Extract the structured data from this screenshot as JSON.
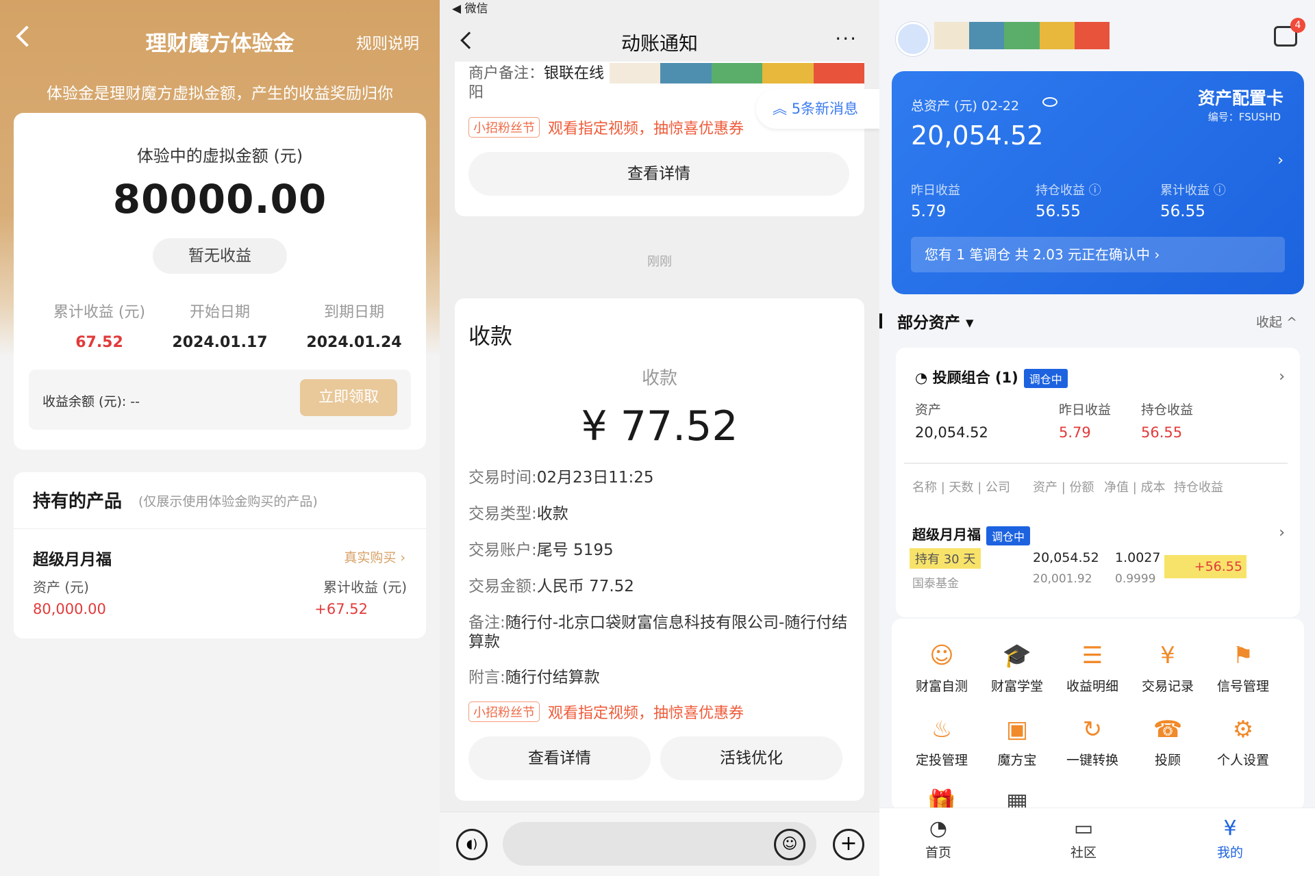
{
  "screen1": {
    "title": "理财魔方体验金",
    "rules_link": "规则说明",
    "subtitle": "体验金是理财魔方虚拟金额，产生的收益奖励归你",
    "virtual_label": "体验中的虚拟金额 (元)",
    "virtual_amount": "80000.00",
    "no_income": "暂无收益",
    "stats": [
      {
        "label": "累计收益 (元)",
        "value": "67.52"
      },
      {
        "label": "开始日期",
        "value": "2024.01.17"
      },
      {
        "label": "到期日期",
        "value": "2024.01.24"
      }
    ],
    "balance_label": "收益余额 (元): --",
    "claim_button": "立即领取",
    "holdings_title": "持有的产品",
    "holdings_note": "(仅展示使用体验金购买的产品)",
    "product_name": "超级月月福",
    "buy_link": "真实购买",
    "asset_label": "资产 (元)",
    "asset_value": "80,000.00",
    "cum_label": "累计收益 (元)",
    "cum_value": "+67.52"
  },
  "screen2": {
    "status": "◀ 微信",
    "title": "动账通知",
    "more": "···",
    "memo_key": "商户备注：",
    "memo_val": "银联在线",
    "memo_tail": "阳",
    "new_messages": "5条新消息",
    "promo_tag": "小招粉丝节",
    "promo_text": "观看指定视频，抽惊喜优惠券",
    "view_details": "查看详情",
    "time": "刚刚",
    "card_title": "收款",
    "card_sub": "收款",
    "amount": "¥ 77.52",
    "rows": [
      {
        "k": "交易时间:",
        "v": "02月23日11:25"
      },
      {
        "k": "交易类型:",
        "v": "收款"
      },
      {
        "k": "交易账户:",
        "v": "尾号 5195"
      },
      {
        "k": "交易金额:",
        "v": "人民币 77.52"
      },
      {
        "k": "备注:",
        "v": "随行付-北京口袋财富信息科技有限公司-随行付结算款"
      },
      {
        "k": "附言:",
        "v": "随行付结算款"
      }
    ],
    "btn_details": "查看详情",
    "btn_optimize": "活钱优化"
  },
  "screen3": {
    "badge": "4",
    "total_label": "总资产 (元)    02-22",
    "total": "20,054.52",
    "card_name": "资产配置卡",
    "card_no": "编号：FSUSHD",
    "metrics": [
      {
        "label": "昨日收益",
        "value": "5.79"
      },
      {
        "label": "持仓收益 ⓘ",
        "value": "56.55"
      },
      {
        "label": "累计收益 ⓘ",
        "value": "56.55"
      }
    ],
    "pending": "您有 1 笔调仓 共 2.03 元正在确认中  ›",
    "section": "部分资产 ▾",
    "collapse": "收起 ^",
    "group_title": "投顾组合 (1)",
    "tag_adjusting": "调仓中",
    "group_heads": [
      "资产",
      "昨日收益",
      "持仓收益"
    ],
    "group_vals": [
      "20,054.52",
      "5.79",
      "56.55"
    ],
    "table_heads": [
      "名称 | 天数 | 公司",
      "资产 | 份额",
      "净值 | 成本",
      "持仓收益"
    ],
    "fund_name": "超级月月福",
    "fund_hold": "持有 30 天",
    "fund_company": "国泰基金",
    "fund_asset": "20,054.52",
    "fund_share": "20,001.92",
    "fund_nav": "1.0027",
    "fund_cost": "0.9999",
    "fund_gain": "+56.55",
    "tools": [
      {
        "label": "财富自测",
        "icon": "☺"
      },
      {
        "label": "财富学堂",
        "icon": "🎓"
      },
      {
        "label": "收益明细",
        "icon": "☰"
      },
      {
        "label": "交易记录",
        "icon": "¥"
      },
      {
        "label": "信号管理",
        "icon": "⚑"
      },
      {
        "label": "定投管理",
        "icon": "♨"
      },
      {
        "label": "魔方宝",
        "icon": "▣"
      },
      {
        "label": "一键转换",
        "icon": "↻"
      },
      {
        "label": "投顾",
        "icon": "☎"
      },
      {
        "label": "个人设置",
        "icon": "⚙"
      }
    ],
    "tabs": [
      {
        "label": "首页",
        "icon": "◔"
      },
      {
        "label": "社区",
        "icon": "▭"
      },
      {
        "label": "我的",
        "icon": "¥"
      }
    ]
  }
}
